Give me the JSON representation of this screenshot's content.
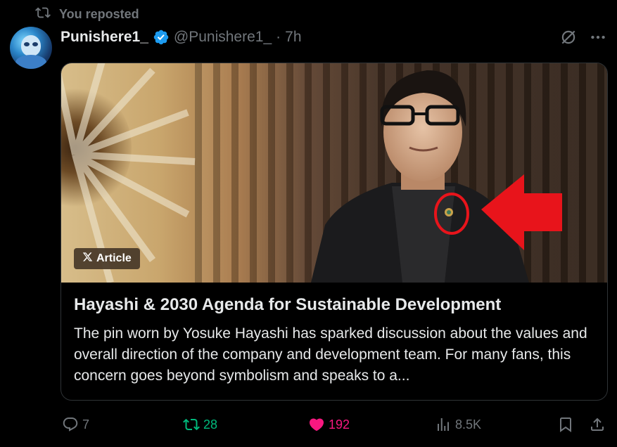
{
  "repost": {
    "label": "You reposted",
    "icon": "repost-icon"
  },
  "author": {
    "name": "Punishere1_",
    "handle": "@Punishere1_",
    "separator": "·",
    "time": "7h",
    "verified": true,
    "avatar": "avatar"
  },
  "header_icons": [
    "grok-icon",
    "more-icon"
  ],
  "article": {
    "badge": "Article",
    "badge_icon": "x-logo-icon",
    "title": "Hayashi & 2030 Agenda for Sustainable Development",
    "description": "The pin worn by Yosuke Hayashi has sparked discussion about the values and overall direction of the company and development team. For many fans, this concern goes beyond symbolism and speaks to a..."
  },
  "actions": {
    "reply": "7",
    "repost": "28",
    "like": "192",
    "views": "8.5K"
  },
  "colors": {
    "background": "#000000",
    "text": "#e7e9ea",
    "muted": "#71767b",
    "verified": "#1d9bf0",
    "repost_active": "#00ba7c",
    "like_active": "#f91880",
    "arrow_red": "#e8141b"
  }
}
